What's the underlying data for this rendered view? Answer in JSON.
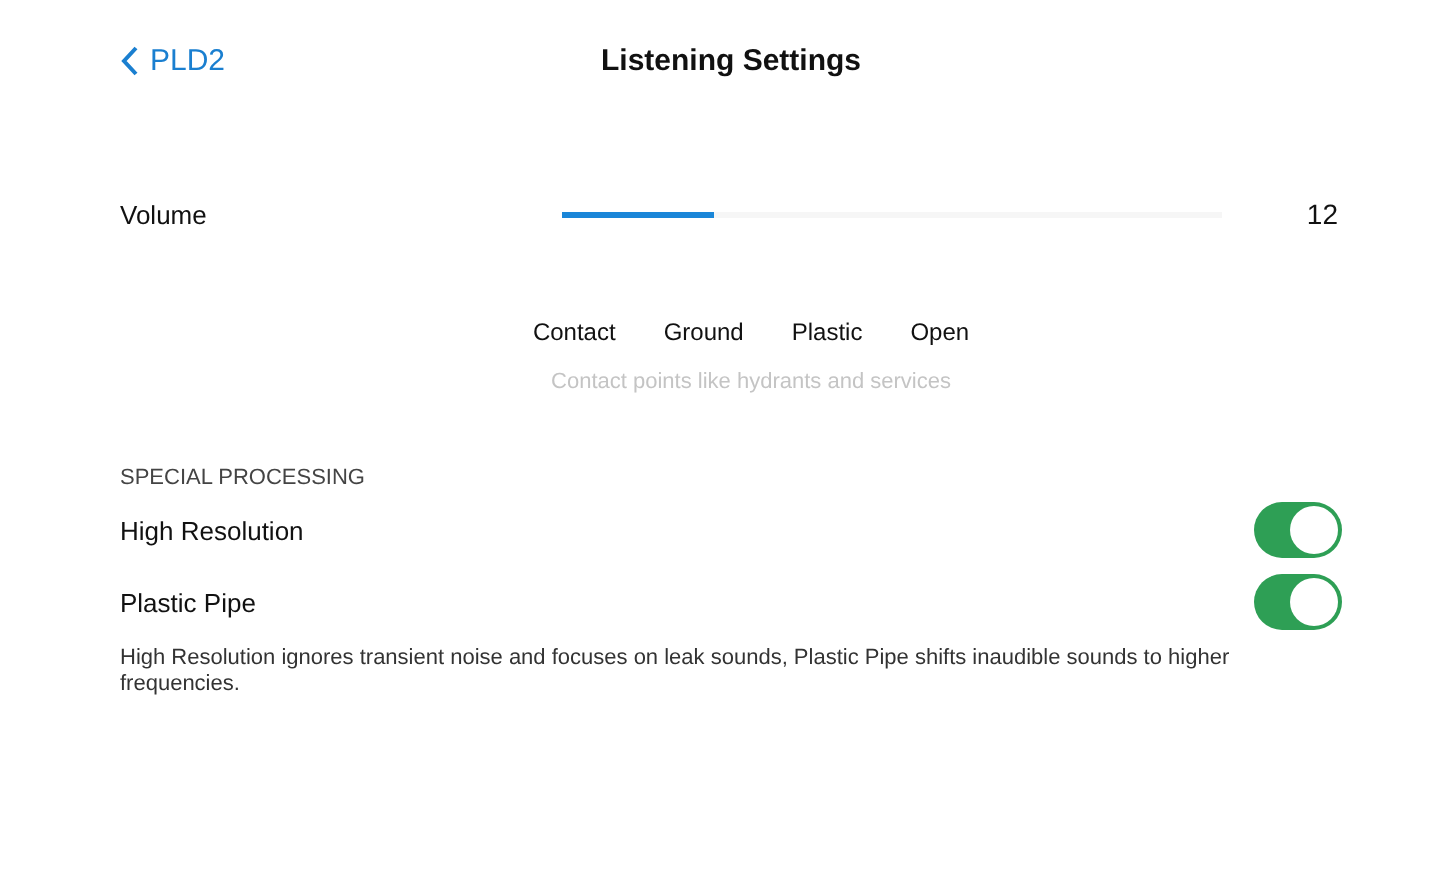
{
  "nav": {
    "back_label": "PLD2",
    "title": "Listening Settings"
  },
  "volume": {
    "label": "Volume",
    "level": 0.23,
    "reading": "12"
  },
  "modes": [
    {
      "label": "Contact"
    },
    {
      "label": "Ground"
    },
    {
      "label": "Plastic"
    },
    {
      "label": "Open"
    }
  ],
  "mode_caption": "Contact points like hydrants and services",
  "special_processing": {
    "header": "SPECIAL PROCESSING",
    "toggles": [
      {
        "label": "High Resolution",
        "on": true
      },
      {
        "label": "Plastic Pipe",
        "on": true
      }
    ],
    "footnote": "High Resolution ignores transient noise and focuses on leak sounds, Plastic Pipe shifts inaudible sounds to higher frequencies."
  }
}
